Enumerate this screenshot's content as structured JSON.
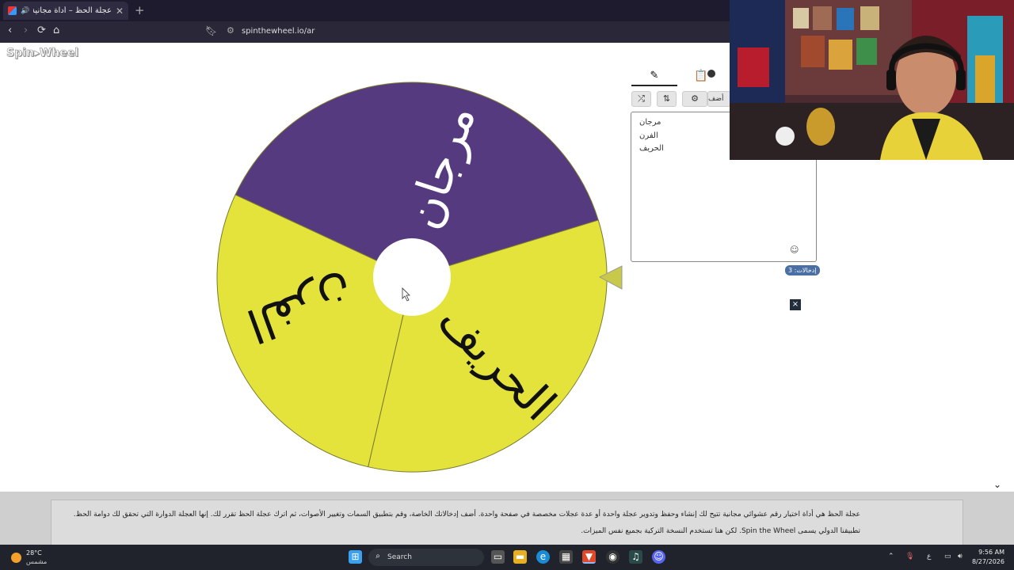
{
  "browser": {
    "tab_title": "عجلة الحظ – أداة مجانية لتدوير",
    "tab_close": "✕",
    "new_tab": "+",
    "url": "spinthewheel.io/ar",
    "back": "‹",
    "forward": "›",
    "reload": "⟳",
    "home": "⌂"
  },
  "logo": {
    "text": "Spin▸Wheel"
  },
  "wheel": {
    "segments": [
      {
        "label": "مرجان",
        "color": "#563a7f"
      },
      {
        "label": "الحريف",
        "color": "#e4e33c"
      },
      {
        "label": "الفرن",
        "color": "#e4e33c"
      }
    ]
  },
  "editor": {
    "tab_edit_icon": "✎",
    "tab_results_icon": "📋",
    "btn_shuffle": "⤮",
    "btn_sort": "⇅",
    "btn_settings": "⚙",
    "btn_add": "أضف",
    "entries": [
      "مرجان",
      "الفرن",
      "الحريف"
    ],
    "emoji": "☺",
    "count_label": "إدخالات: 3",
    "close": "×"
  },
  "scroll_chevron": "⌄",
  "banner": {
    "line1": "عجلة الحظ هي أداة اختيار رقم عشوائي مجانية تتيح لك إنشاء وحفظ وتدوير عجلة واحدة أو عدة عجلات مخصصة في صفحة واحدة. أضف إدخالاتك الخاصة، وقم بتطبيق السمات وتغيير الأصوات، ثم اترك عجلة الحظ تقرر لك. إنها العجلة الدوارة التي تحقق لك دوامة الحظ.",
    "line2": "تطبيقنا الدولي يسمى Spin the Wheel. لكن هنا تستخدم النسخة التركية بجميع نفس الميزات."
  },
  "taskbar": {
    "temp": "28°C",
    "condition": "مشمس",
    "search": "Search",
    "time": "9:56 AM",
    "date": "8/27/2026",
    "lang": "ع"
  }
}
